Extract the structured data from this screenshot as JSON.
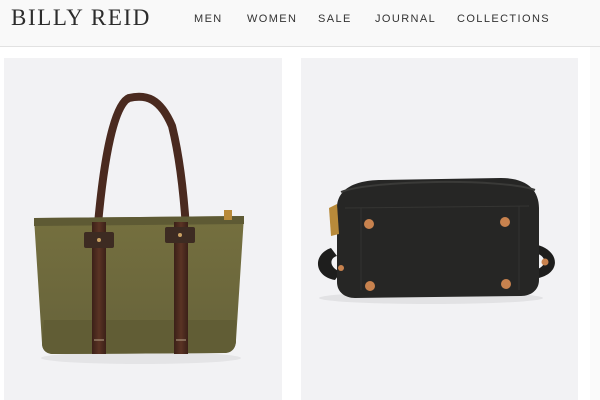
{
  "header": {
    "logo": "BILLY REID",
    "nav": [
      {
        "label": "MEN"
      },
      {
        "label": "WOMEN"
      },
      {
        "label": "SALE"
      },
      {
        "label": "JOURNAL"
      },
      {
        "label": "COLLECTIONS"
      }
    ]
  },
  "products": [
    {
      "name": "tote-bag",
      "color": "#6e6b3b",
      "strap_color": "#4a2a1f"
    },
    {
      "name": "dopp-kit",
      "color": "#252524",
      "rivet_color": "#c8824e"
    }
  ],
  "colors": {
    "header_bg": "#f9f9f9",
    "card_bg": "#f2f2f4",
    "text": "#333333"
  }
}
